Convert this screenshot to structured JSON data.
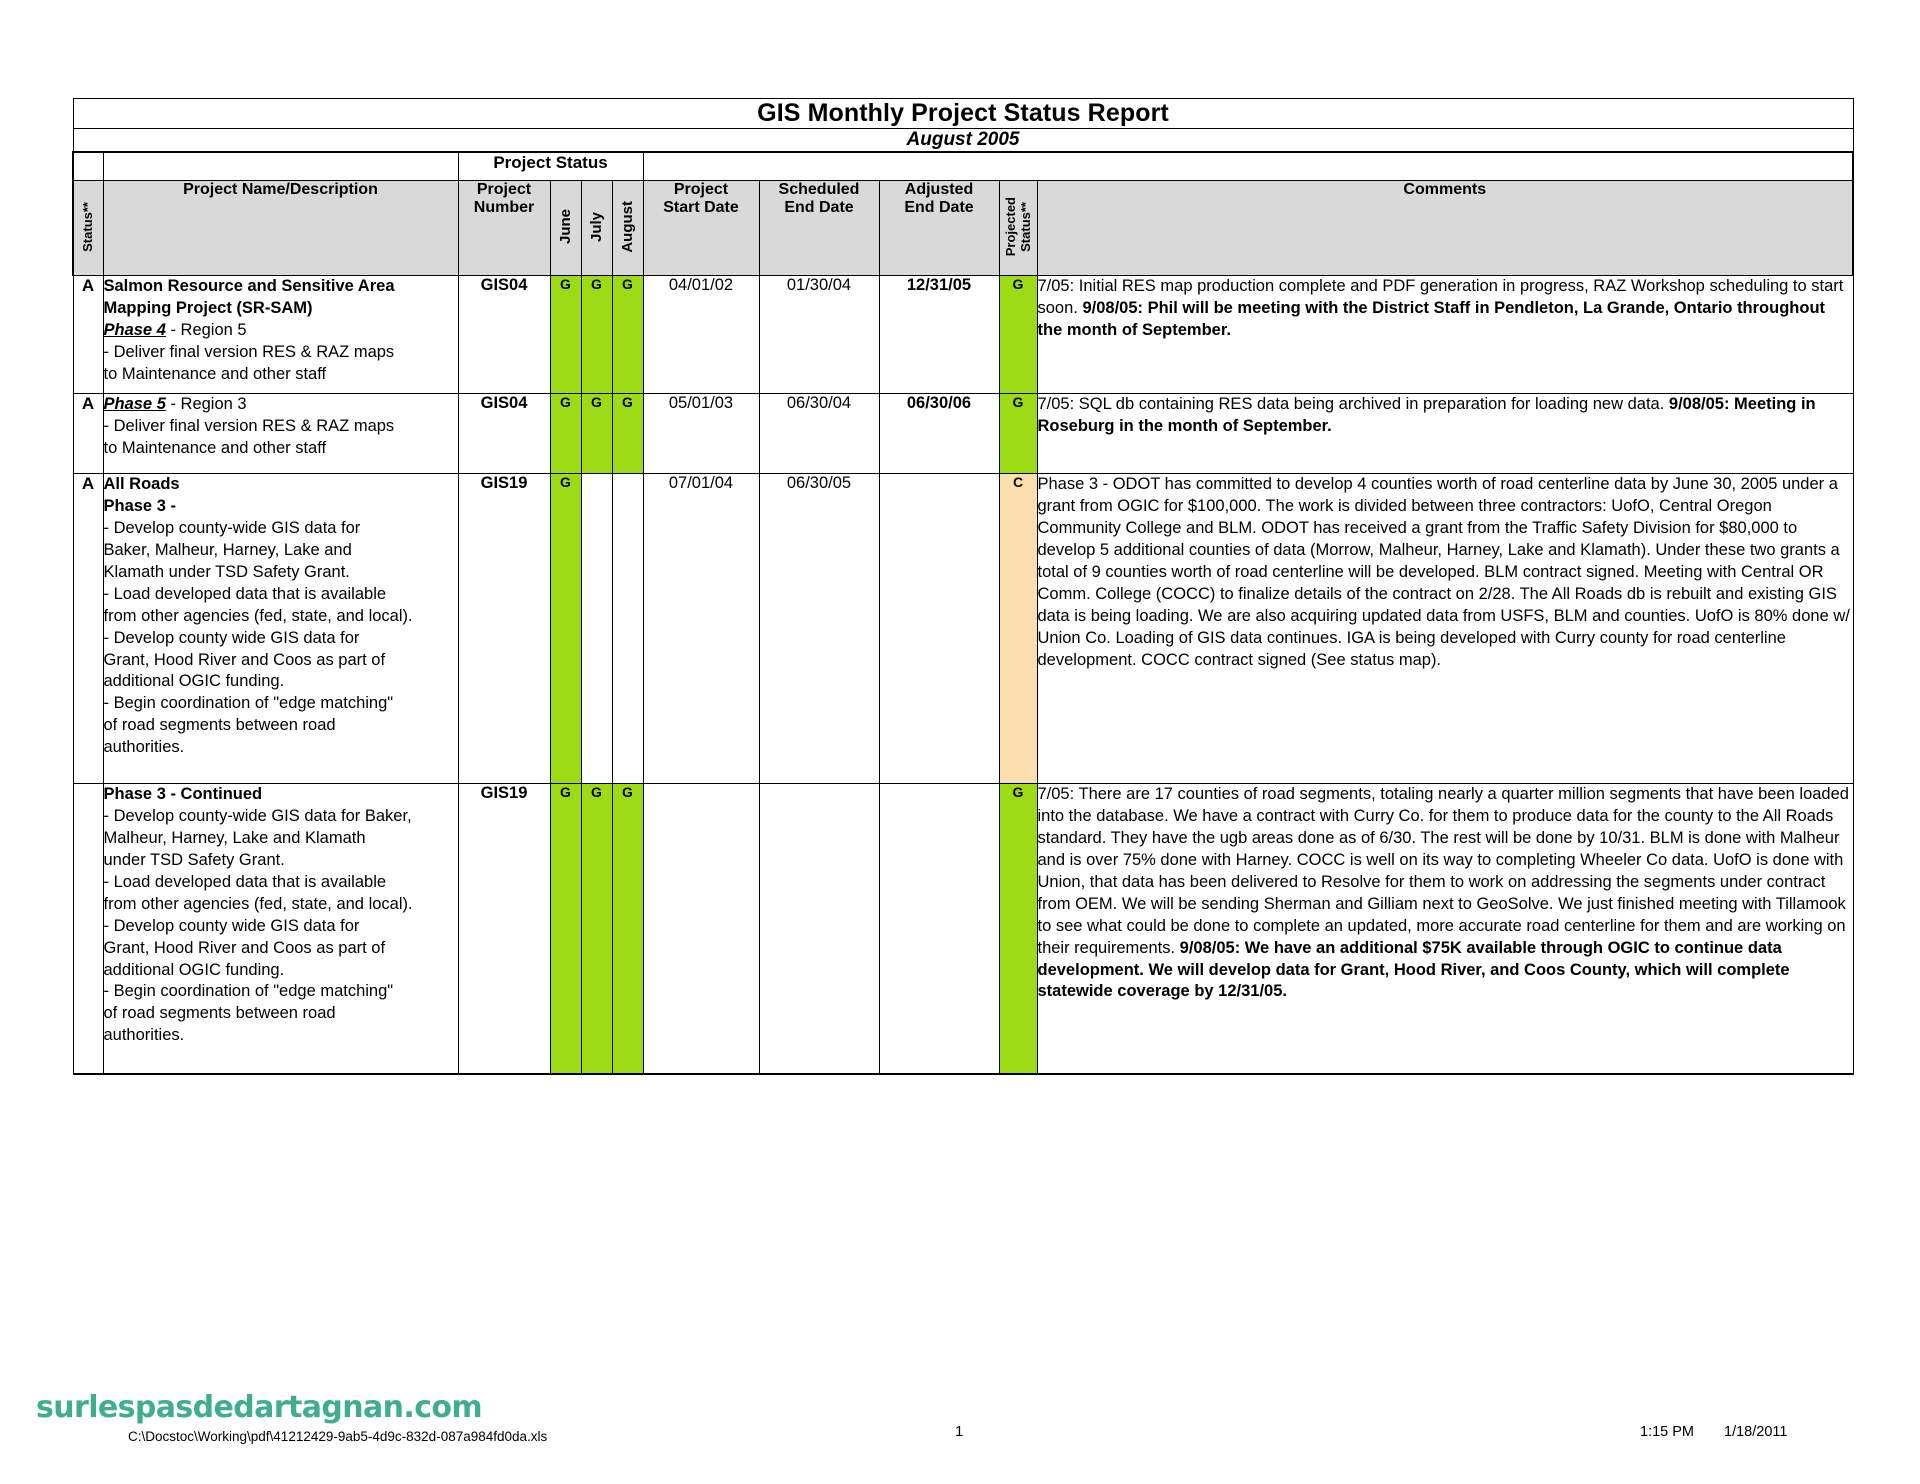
{
  "report": {
    "title": "GIS Monthly Project Status Report",
    "subtitle": "August 2005",
    "group_header_project_status": "Project Status",
    "columns": {
      "status": "Status**",
      "project_name": "Project Name/Description",
      "project_number": "Project\nNumber",
      "project_number_l1": "Project",
      "project_number_l2": "Number",
      "june": "June",
      "july": "July",
      "august": "August",
      "project_start_l1": "Project",
      "project_start_l2": "Start Date",
      "scheduled_end_l1": "Scheduled",
      "scheduled_end_l2": "End Date",
      "adjusted_end_l1": "Adjusted",
      "adjusted_end_l2": "End Date",
      "projected_status_l1": "Projected",
      "projected_status_l2": "Status**",
      "comments": "Comments"
    },
    "rows": [
      {
        "status": "A",
        "desc_lines": [
          {
            "text": "Salmon Resource and Sensitive Area",
            "style": "bold"
          },
          {
            "text": "Mapping Project (SR-SAM)",
            "style": "bold"
          },
          {
            "text": "Phase 4",
            "style": "phase",
            "suffix": " - Region 5"
          },
          {
            "text": " - Deliver final version RES & RAZ maps",
            "style": "plain"
          },
          {
            "text": "to Maintenance and other staff",
            "style": "plain"
          }
        ],
        "project_number": "GIS04",
        "june": "G",
        "july": "G",
        "august": "G",
        "project_start_date": "04/01/02",
        "scheduled_end_date": "01/30/04",
        "adjusted_end_date": "12/31/05",
        "projected_status": "G",
        "comments_segments": [
          {
            "text": "7/05: Initial RES map production complete and PDF generation in progress, RAZ Workshop scheduling to start soon.  ",
            "bold": false
          },
          {
            "text": "9/08/05:  Phil will be meeting with the District Staff in Pendleton, La Grande, Ontario throughout the month of September.",
            "bold": true
          }
        ]
      },
      {
        "status": "A",
        "desc_lines": [
          {
            "text": "Phase 5",
            "style": "phase",
            "suffix": "  - Region 3"
          },
          {
            "text": " - Deliver final version RES & RAZ maps",
            "style": "plain"
          },
          {
            "text": "to Maintenance and other staff",
            "style": "plain"
          }
        ],
        "project_number": "GIS04",
        "june": "G",
        "july": "G",
        "august": "G",
        "project_start_date": "05/01/03",
        "scheduled_end_date": "06/30/04",
        "adjusted_end_date": "06/30/06",
        "projected_status": "G",
        "comments_segments": [
          {
            "text": "7/05: SQL db containing RES data being archived in preparation for loading new data.  ",
            "bold": false
          },
          {
            "text": "9/08/05:  Meeting in Roseburg in the month of September.",
            "bold": true
          }
        ]
      },
      {
        "status": "A",
        "desc_lines": [
          {
            "text": "All Roads",
            "style": "bold"
          },
          {
            "text": "Phase 3 -",
            "style": "boldline"
          },
          {
            "text": " - Develop county-wide GIS data for",
            "style": "plain"
          },
          {
            "text": "Baker, Malheur, Harney, Lake and",
            "style": "plain"
          },
          {
            "text": "Klamath under TSD Safety Grant.",
            "style": "plain"
          },
          {
            "text": " - Load developed data that is available",
            "style": "plain"
          },
          {
            "text": "from other agencies (fed, state, and local).",
            "style": "plain"
          },
          {
            "text": " -  Develop county wide GIS data for",
            "style": "plain"
          },
          {
            "text": "Grant, Hood River and Coos as part of",
            "style": "plain"
          },
          {
            "text": "additional OGIC funding.",
            "style": "plain"
          },
          {
            "text": " -  Begin coordination of \"edge matching\"",
            "style": "plain"
          },
          {
            "text": "of road segments between road",
            "style": "plain"
          },
          {
            "text": "authorities.",
            "style": "plain"
          }
        ],
        "project_number": "GIS19",
        "june": "G",
        "july": "",
        "august": "",
        "project_start_date": "07/01/04",
        "scheduled_end_date": "06/30/05",
        "adjusted_end_date": "",
        "projected_status": "C",
        "comments_segments": [
          {
            "text": "Phase 3 - ODOT has committed to develop 4 counties worth of road centerline data by June 30, 2005 under a grant from OGIC for $100,000.  The work is divided between three contractors: UofO, Central Oregon Community College and BLM.  ODOT has received a grant from the Traffic Safety Division for $80,000 to develop 5 additional counties of data (Morrow, Malheur, Harney, Lake and Klamath).  Under these two grants a total of 9 counties worth of road centerline will be developed.  BLM contract signed. Meeting with Central OR Comm. College (COCC) to finalize details of the contract on 2/28.  The All Roads db is rebuilt and existing GIS data is being loading.  We are also acquiring updated data from USFS, BLM and counties.  UofO is 80% done w/ Union Co.  Loading of GIS data continues.  IGA is being developed with Curry county for road centerline development. COCC contract signed (See status map).",
            "bold": false
          }
        ]
      },
      {
        "status": "",
        "desc_lines": [
          {
            "text": "Phase 3 - Continued",
            "style": "bold"
          },
          {
            "text": "- Develop county-wide GIS data for Baker,",
            "style": "plain"
          },
          {
            "text": "Malheur, Harney, Lake and Klamath",
            "style": "plain"
          },
          {
            "text": "under TSD Safety Grant.",
            "style": "plain"
          },
          {
            "text": " - Load developed data that is available",
            "style": "plain"
          },
          {
            "text": "from other agencies (fed, state, and local).",
            "style": "plain"
          },
          {
            "text": " -  Develop county wide GIS data for",
            "style": "plain"
          },
          {
            "text": "Grant, Hood River and Coos as part of",
            "style": "plain"
          },
          {
            "text": "additional OGIC funding.",
            "style": "plain"
          },
          {
            "text": "-  Begin coordination of \"edge matching\"",
            "style": "plain"
          },
          {
            "text": "of road segments between road",
            "style": "plain"
          },
          {
            "text": "authorities.",
            "style": "plain"
          }
        ],
        "project_number": "GIS19",
        "june": "G",
        "july": "G",
        "august": "G",
        "project_start_date": "",
        "scheduled_end_date": "",
        "adjusted_end_date": "",
        "projected_status": "G",
        "comments_segments": [
          {
            "text": "7/05: There are 17 counties of road segments, totaling nearly a quarter million segments that have been loaded into the database.  We have a contract with Curry Co. for them to produce data for the county to the All Roads standard.  They have the ugb areas done as of 6/30.  The rest will be done by 10/31.  BLM is done with Malheur and is over 75% done with Harney.  COCC is well on its way to completing Wheeler Co data.  UofO is done with Union, that data has been delivered to Resolve for them to work on addressing the segments under contract from OEM.  We will be sending Sherman and Gilliam next to GeoSolve.  We just finished meeting with Tillamook to see what could be done to complete an updated, more accurate road centerline for them and are working on their requirements.  ",
            "bold": false
          },
          {
            "text": "9/08/05: We have an additional $75K available through OGIC to continue data development.  We will develop data for Grant, Hood River, and Coos County, which will complete statewide coverage by 12/31/05.",
            "bold": true
          }
        ]
      }
    ]
  },
  "colors": {
    "status_green": "#9ddb15",
    "status_caution": "#fcdfae",
    "header_gray": "#d9d9d9",
    "watermark_green": "#3fae8f"
  },
  "footer": {
    "watermark": "surlespasdedartagnan.com",
    "file_path": "C:\\Docstoc\\Working\\pdf\\41212429-9ab5-4d9c-832d-087a984fd0da.xls",
    "page_number": "1",
    "time": "1:15 PM",
    "date": "1/18/2011"
  }
}
